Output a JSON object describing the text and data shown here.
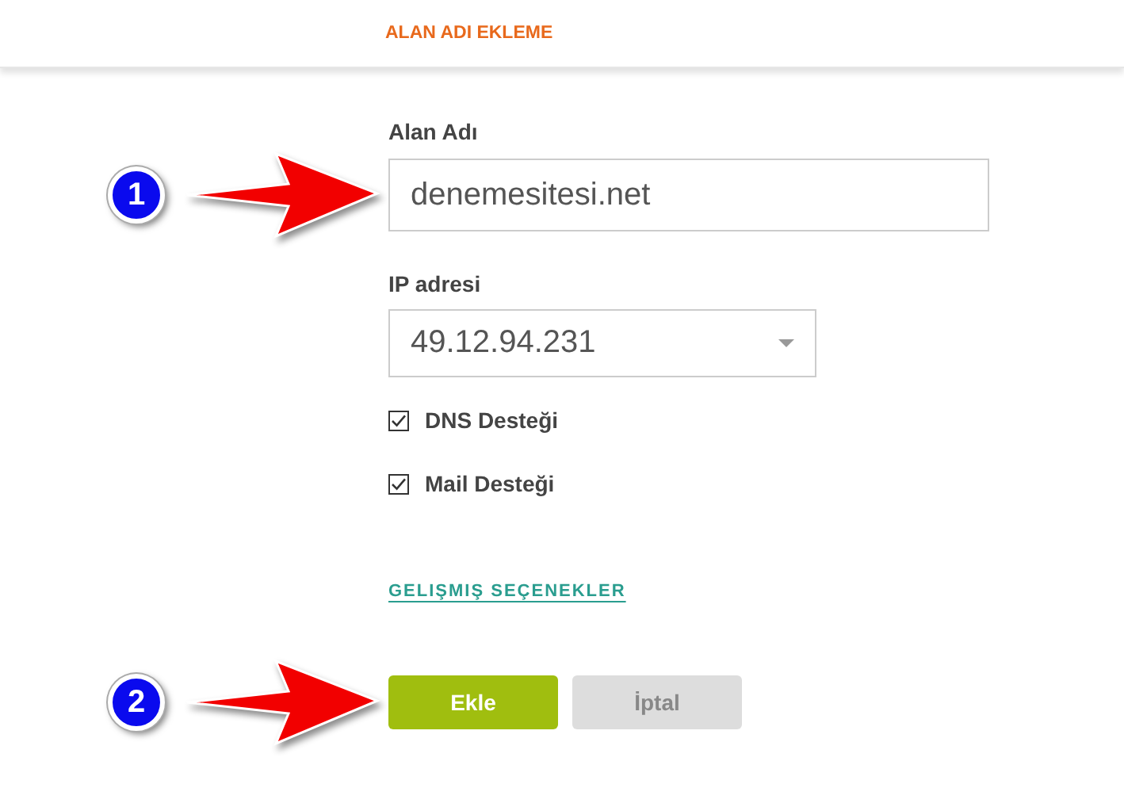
{
  "header": {
    "title": "ALAN ADI EKLEME"
  },
  "domain": {
    "label": "Alan Adı",
    "value": "denemesitesi.net",
    "callout": "1"
  },
  "ip": {
    "label": "IP adresi",
    "value": "49.12.94.231"
  },
  "options": [
    {
      "label": "DNS Desteği",
      "checked": true
    },
    {
      "label": "Mail Desteği",
      "checked": true
    }
  ],
  "advanced_link": "GELIŞMIŞ SEÇENEKLER",
  "actions": {
    "callout": "2",
    "buttons": [
      {
        "label": "Ekle",
        "kind": "primary"
      },
      {
        "label": "İptal",
        "kind": "secondary"
      }
    ]
  }
}
